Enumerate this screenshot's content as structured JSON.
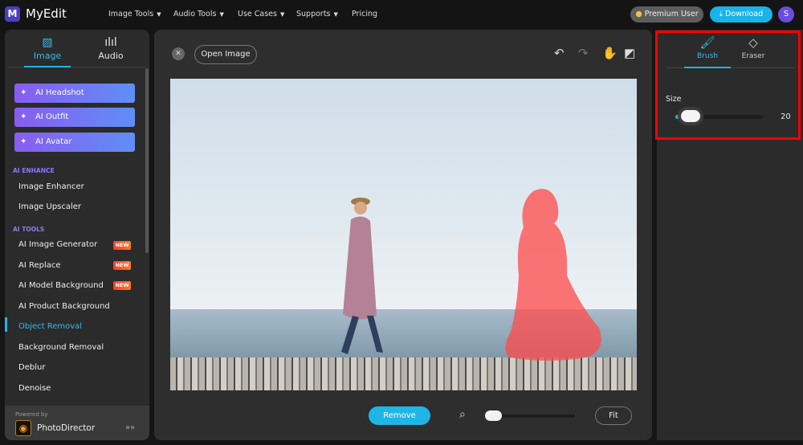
{
  "header": {
    "logo": "M",
    "brand": "MyEdit",
    "nav": [
      {
        "label": "Image Tools"
      },
      {
        "label": "Audio Tools"
      },
      {
        "label": "Use Cases"
      },
      {
        "label": "Supports"
      },
      {
        "label": "Pricing"
      }
    ],
    "premium": "Premium User",
    "download": "Download",
    "avatar": "S"
  },
  "sidebar": {
    "tabs": [
      {
        "label": "Image"
      },
      {
        "label": "Audio"
      }
    ],
    "ai_buttons": [
      {
        "label": "AI Headshot"
      },
      {
        "label": "AI Outfit"
      },
      {
        "label": "AI Avatar"
      }
    ],
    "sections": {
      "enhance": "AI ENHANCE",
      "tools": "AI TOOLS"
    },
    "enhance_items": [
      {
        "label": "Image Enhancer"
      },
      {
        "label": "Image Upscaler"
      }
    ],
    "tool_items": [
      {
        "label": "AI Image Generator",
        "badge": "NEW"
      },
      {
        "label": "AI Replace",
        "badge": "NEW"
      },
      {
        "label": "AI Model Background",
        "badge": "NEW"
      },
      {
        "label": "AI Product Background"
      },
      {
        "label": "Object Removal"
      },
      {
        "label": "Background Removal"
      },
      {
        "label": "Deblur"
      },
      {
        "label": "Denoise"
      }
    ],
    "active": "Object Removal",
    "powered_by": "Powered by",
    "product": "PhotoDirector"
  },
  "editor": {
    "open_image": "Open Image",
    "remove": "Remove",
    "fit": "Fit"
  },
  "brush_panel": {
    "tabs": [
      {
        "label": "Brush"
      },
      {
        "label": "Eraser"
      }
    ],
    "active_tab": "Brush",
    "size_label": "Size",
    "size_value": "20"
  },
  "colors": {
    "accent": "#1fb6e6",
    "highlight": "#ff0000"
  }
}
